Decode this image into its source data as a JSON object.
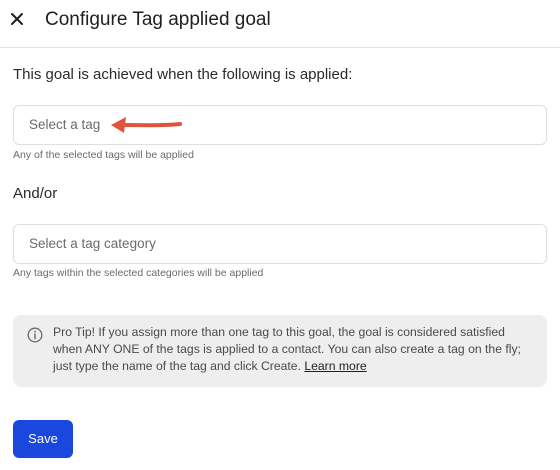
{
  "header": {
    "title": "Configure Tag applied goal",
    "close_icon": "close-icon"
  },
  "form": {
    "intro": "This goal is achieved when the following is applied:",
    "tag_select": {
      "placeholder": "Select a tag",
      "hint": "Any of the selected tags will be applied"
    },
    "andor_label": "And/or",
    "category_select": {
      "placeholder": "Select a tag category",
      "hint": "Any tags within the selected categories will be applied"
    }
  },
  "tip": {
    "icon": "info-icon",
    "text": "Pro Tip! If you assign more than one tag to this goal, the goal is considered satisfied when ANY ONE of the tags is applied to a contact. You can also create a tag on the fly; just type the name of the tag and click Create. ",
    "link_label": "Learn more"
  },
  "actions": {
    "save_label": "Save"
  },
  "colors": {
    "primary_button": "#1a47dd",
    "annotation_arrow": "#e0533d",
    "tip_background": "#eeeeee"
  }
}
